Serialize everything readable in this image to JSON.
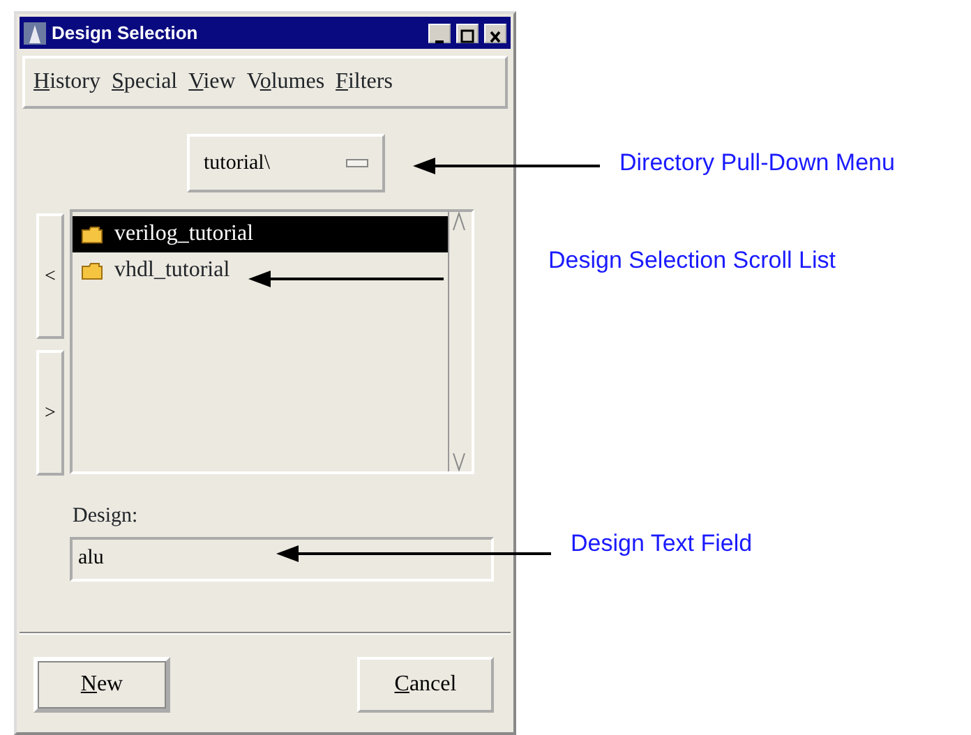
{
  "window": {
    "title": "Design Selection"
  },
  "menu": [
    {
      "key": "H",
      "after": "istory"
    },
    {
      "key": "S",
      "after": "pecial"
    },
    {
      "key": "V",
      "after": "iew"
    },
    {
      "before": "V",
      "key": "o",
      "after": "lumes"
    },
    {
      "key": "F",
      "after": "ilters"
    }
  ],
  "directory_menu": {
    "value": "tutorial\\"
  },
  "nav_buttons": [
    {
      "label": "<"
    },
    {
      "label": ">"
    }
  ],
  "design_list": [
    {
      "name": "verilog_tutorial",
      "selected": true
    },
    {
      "name": "vhdl_tutorial",
      "selected": false
    }
  ],
  "design_field": {
    "label": "Design:",
    "value": "alu"
  },
  "buttons": [
    {
      "key": "N",
      "after": "ew",
      "default": true
    },
    {
      "key": "C",
      "after": "ancel",
      "default": false
    }
  ],
  "annotations": [
    {
      "text": "Directory Pull-Down Menu"
    },
    {
      "text": "Design Selection Scroll List"
    },
    {
      "text": "Design Text Field"
    }
  ]
}
